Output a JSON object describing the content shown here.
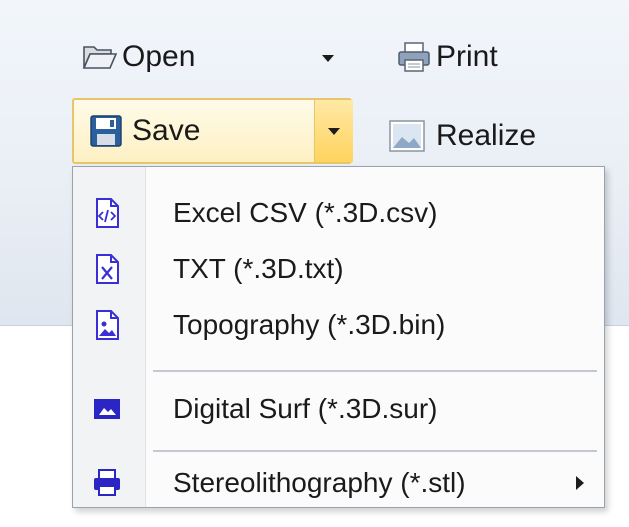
{
  "toolbar": {
    "open_label": "Open",
    "print_label": "Print",
    "save_label": "Save",
    "realize_label": "Realize"
  },
  "save_menu": {
    "items": [
      {
        "label": "Excel CSV (*.3D.csv)",
        "icon": "code-file-icon"
      },
      {
        "label": "TXT (*.3D.txt)",
        "icon": "txt-file-icon"
      },
      {
        "label": "Topography (*.3D.bin)",
        "icon": "image-file-icon"
      },
      {
        "label": "Digital Surf (*.3D.sur)",
        "icon": "surface-icon"
      },
      {
        "label": "Stereolithography (*.stl)",
        "icon": "printer-icon",
        "has_submenu": true
      }
    ]
  },
  "colors": {
    "accent": "#3a2fd6",
    "hover_border": "#e8c46a",
    "hover_fill": "#ffd35e"
  }
}
